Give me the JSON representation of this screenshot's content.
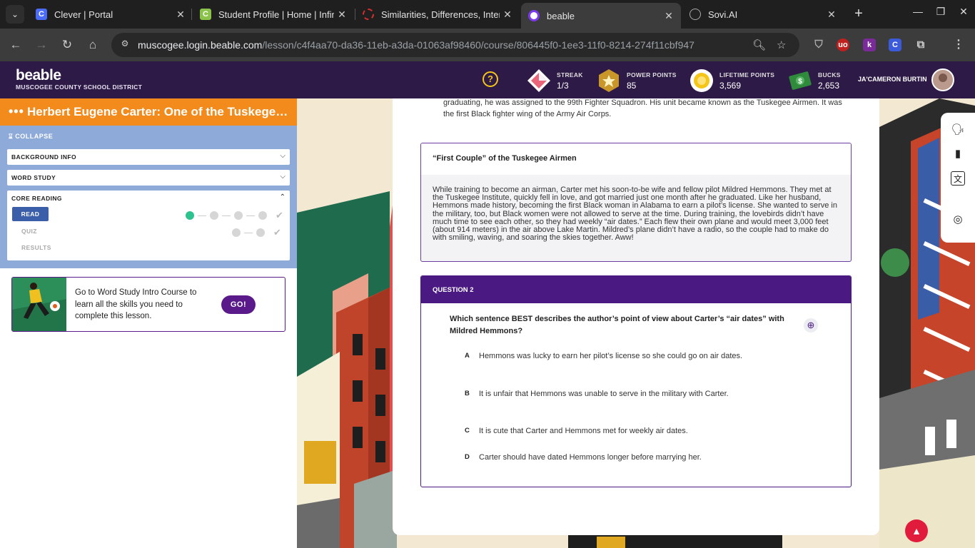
{
  "browser": {
    "tabs": [
      {
        "title": "Clever | Portal",
        "favicon_color": "#4a6cf7",
        "favicon_letter": "C"
      },
      {
        "title": "Student Profile | Home | Infinite",
        "favicon_color": "#8bc34a",
        "favicon_letter": "C"
      },
      {
        "title": "Similarities, Differences, Interest",
        "favicon_color": "#d32f2f",
        "favicon_letter": ""
      },
      {
        "title": "beable",
        "favicon_color": "#7c3aed",
        "favicon_letter": "b",
        "active": true
      },
      {
        "title": "Sovi.AI",
        "favicon_color": "#222222",
        "favicon_letter": "S"
      }
    ],
    "url_host": "muscogee.login.beable.com",
    "url_path": "/lesson/c4f4aa70-da36-11eb-a3da-01063af98460/course/806445f0-1ee3-11f0-8214-274f11cbf947",
    "extensions": [
      {
        "label": "uo",
        "color": "#c0201e"
      },
      {
        "label": "k",
        "color": "#7b2a9a"
      },
      {
        "label": "C",
        "color": "#3b5bdb"
      }
    ]
  },
  "app": {
    "logo": "beable",
    "district": "MUSCOGEE COUNTY SCHOOL DISTRICT",
    "help": "?",
    "stats": [
      {
        "label": "STREAK",
        "value": "1/3"
      },
      {
        "label": "POWER POINTS",
        "value": "85"
      },
      {
        "label": "LIFETIME POINTS",
        "value": "3,569"
      },
      {
        "label": "BUCKS",
        "value": "2,653"
      }
    ],
    "user_name": "JA'CAMERON BURTIN"
  },
  "lesson": {
    "title": "Herbert Eugene Carter: One of the Tuskegee Airmen",
    "collapse": "COLLAPSE",
    "sections": [
      {
        "label": "BACKGROUND INFO"
      },
      {
        "label": "WORD STUDY"
      },
      {
        "label": "CORE READING"
      }
    ],
    "core_items": [
      "READ",
      "QUIZ",
      "RESULTS"
    ]
  },
  "promo": {
    "text": "Go to Word Study Intro Course to learn all the skills you need to complete this lesson.",
    "button": "GO!"
  },
  "reading": {
    "intro": "graduating, he was assigned to the 99th Fighter Squadron. His unit became known as the Tuskegee Airmen. It was the first Black fighter wing of the Army Air Corps.",
    "box_title": "“First Couple” of the Tuskegee Airmen",
    "box_body": "While training to become an airman, Carter met his soon-to-be wife and fellow pilot Mildred Hemmons. They met at the Tuskegee Institute, quickly fell in love, and got married just one month after he graduated. Like her husband, Hemmons made history, becoming the first Black woman in Alabama to earn a pilot’s license. She wanted to serve in the military, too, but Black women were not allowed to serve at the time. During training, the lovebirds didn’t have much time to see each other, so they had weekly “air dates.” Each flew their own plane and would meet 3,000 feet (about 914 meters) in the air above Lake Martin. Mildred’s plane didn’t have a radio, so the couple had to make do with smiling, waving, and soaring the skies together. Aww!"
  },
  "question": {
    "header": "QUESTION 2",
    "text": "Which sentence BEST describes the author’s point of view about Carter’s “air dates” with Mildred Hemmons?",
    "options": [
      {
        "letter": "A",
        "text": "Hemmons was lucky to earn her pilot’s license so she could go on air dates."
      },
      {
        "letter": "B",
        "text": "It is unfair that Hemmons was unable to serve in the military with Carter."
      },
      {
        "letter": "C",
        "text": "It is cute that Carter and Hemmons met for weekly air dates."
      },
      {
        "letter": "D",
        "text": "Carter should have dated Hemmons longer before marrying her."
      }
    ]
  },
  "colors": {
    "header_purple": "#2e1a47",
    "lesson_orange": "#f28a1c",
    "sidebar_blue": "#8eaad8",
    "question_purple": "#4a1a82",
    "progress_green": "#2ec28f"
  }
}
